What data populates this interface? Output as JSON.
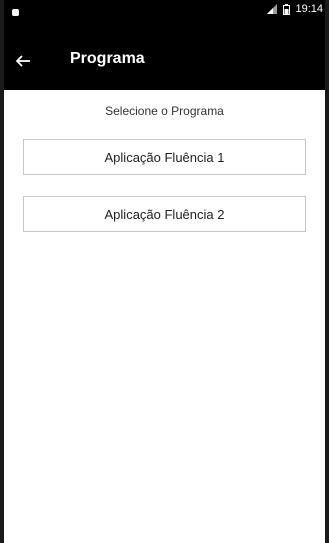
{
  "status_bar": {
    "time": "19:14",
    "icons": [
      "notification-dot-icon",
      "signal-icon",
      "battery-icon"
    ]
  },
  "app_bar": {
    "back_icon": "arrow-left-icon",
    "title": "Programa"
  },
  "main": {
    "prompt": "Selecione o Programa",
    "programs": [
      {
        "label": "Aplicação Fluência 1"
      },
      {
        "label": "Aplicação Fluência 2"
      }
    ]
  },
  "colors": {
    "app_bar_bg": "#000000",
    "app_bar_text": "#ffffff",
    "page_bg": "#ffffff",
    "button_border": "#c8c8c8"
  }
}
